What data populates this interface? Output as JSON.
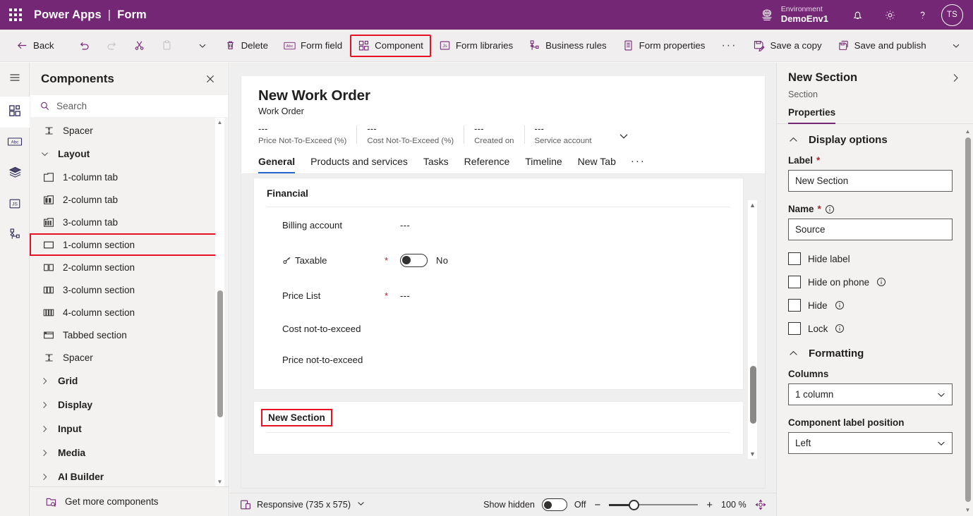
{
  "header": {
    "waffle_icon": "waffle-grid-icon",
    "brand": "Power Apps",
    "separator": "|",
    "app_name": "Form",
    "environment_label": "Environment",
    "environment_name": "DemoEnv1",
    "environment_icon": "environment-globe-icon",
    "notifications_icon": "bell-icon",
    "settings_icon": "gear-icon",
    "help_icon": "question-icon",
    "avatar_initials": "TS",
    "brand_color": "#742774"
  },
  "commandbar": {
    "back": "Back",
    "undo_icon": "undo-icon",
    "redo_icon": "redo-icon",
    "cut_icon": "cut-scissors-icon",
    "paste_icon": "paste-clipboard-icon",
    "more_chevron_icon": "chevron-down-icon",
    "delete": "Delete",
    "form_field": "Form field",
    "component": "Component",
    "form_libraries": "Form libraries",
    "business_rules": "Business rules",
    "form_properties": "Form properties",
    "overflow": "···",
    "save_a_copy": "Save a copy",
    "save_and_publish": "Save and publish",
    "save_chevron_icon": "chevron-down-icon",
    "highlight_color": "#e81123"
  },
  "rail": {
    "items": [
      {
        "name": "hamburger-menu-icon"
      },
      {
        "name": "components-icon",
        "selected": true
      },
      {
        "name": "form-fields-abc-icon"
      },
      {
        "name": "layers-tree-icon"
      },
      {
        "name": "js-libraries-icon"
      },
      {
        "name": "business-rules-icon"
      }
    ]
  },
  "components_panel": {
    "title": "Components",
    "close_icon": "close-icon",
    "search_icon": "search-icon",
    "search_value": "",
    "search_placeholder": "Search",
    "items": [
      {
        "label": "Spacer",
        "icon": "spacer-icon",
        "type": "item"
      },
      {
        "label": "Layout",
        "icon": "chevron-down-icon",
        "type": "group",
        "expanded": true
      },
      {
        "label": "1-column tab",
        "icon": "one-column-tab-icon",
        "type": "item"
      },
      {
        "label": "2-column tab",
        "icon": "two-column-tab-icon",
        "type": "item"
      },
      {
        "label": "3-column tab",
        "icon": "three-column-tab-icon",
        "type": "item"
      },
      {
        "label": "1-column section",
        "icon": "one-column-section-icon",
        "type": "item",
        "highlighted": true
      },
      {
        "label": "2-column section",
        "icon": "two-column-section-icon",
        "type": "item"
      },
      {
        "label": "3-column section",
        "icon": "three-column-section-icon",
        "type": "item"
      },
      {
        "label": "4-column section",
        "icon": "four-column-section-icon",
        "type": "item"
      },
      {
        "label": "Tabbed section",
        "icon": "tabbed-section-icon",
        "type": "item"
      },
      {
        "label": "Spacer",
        "icon": "spacer-icon",
        "type": "item"
      },
      {
        "label": "Grid",
        "icon": "chevron-right-icon",
        "type": "group",
        "expanded": false
      },
      {
        "label": "Display",
        "icon": "chevron-right-icon",
        "type": "group",
        "expanded": false
      },
      {
        "label": "Input",
        "icon": "chevron-right-icon",
        "type": "group",
        "expanded": false
      },
      {
        "label": "Media",
        "icon": "chevron-right-icon",
        "type": "group",
        "expanded": false
      },
      {
        "label": "AI Builder",
        "icon": "chevron-right-icon",
        "type": "group",
        "expanded": false
      }
    ],
    "footer_label": "Get more components",
    "footer_icon": "get-more-components-icon"
  },
  "canvas": {
    "form_title": "New Work Order",
    "form_subtitle": "Work Order",
    "header_fields": [
      {
        "value": "---",
        "label": "Price Not-To-Exceed (%)"
      },
      {
        "value": "---",
        "label": "Cost Not-To-Exceed (%)"
      },
      {
        "value": "---",
        "label": "Created on"
      },
      {
        "value": "---",
        "label": "Service account"
      }
    ],
    "header_chevron_icon": "chevron-down-icon",
    "tabs": [
      {
        "label": "General",
        "active": true
      },
      {
        "label": "Products and services",
        "active": false
      },
      {
        "label": "Tasks",
        "active": false
      },
      {
        "label": "Reference",
        "active": false
      },
      {
        "label": "Timeline",
        "active": false
      },
      {
        "label": "New Tab",
        "active": false
      }
    ],
    "tabs_overflow": "···",
    "section_financial": {
      "title": "Financial",
      "rows": [
        {
          "label": "Billing account",
          "required": "",
          "value": "---",
          "control": "text",
          "icon": ""
        },
        {
          "label": "Taxable",
          "required": "*",
          "value": "No",
          "control": "toggle",
          "icon": "lock-key-icon"
        },
        {
          "label": "Price List",
          "required": "*",
          "value": "---",
          "control": "text",
          "icon": ""
        },
        {
          "label": "Cost not-to-exceed",
          "required": "",
          "value": "",
          "control": "text",
          "icon": ""
        },
        {
          "label": "Price not-to-exceed",
          "required": "",
          "value": "",
          "control": "text",
          "icon": ""
        }
      ]
    },
    "section_new": {
      "title": "New Section",
      "highlighted": true
    },
    "scroll_up_icon": "scroll-up-arrow-icon",
    "scroll_down_icon": "scroll-down-arrow-icon"
  },
  "statusbar": {
    "device_icon": "responsive-device-icon",
    "device_label": "Responsive (735 x 575)",
    "device_chevron_icon": "chevron-down-icon",
    "show_hidden_label": "Show hidden",
    "show_hidden_state": "Off",
    "zoom_out_icon": "minus-icon",
    "zoom_in_icon": "plus-icon",
    "zoom_value": "100 %",
    "fit_icon": "fit-to-screen-icon"
  },
  "properties": {
    "title": "New Section",
    "expand_icon": "chevron-right-icon",
    "subtitle": "Section",
    "tab_label": "Properties",
    "accent_color": "#742774",
    "display_options": {
      "section_title": "Display options",
      "collapse_icon": "chevron-up-icon",
      "label_field_label": "Label",
      "label_field_required": "*",
      "label_field_value": "New Section",
      "name_field_label": "Name",
      "name_field_required": "*",
      "name_field_info_icon": "info-icon",
      "name_field_value": "Source",
      "checkboxes": [
        {
          "label": "Hide label",
          "checked": false,
          "info": false
        },
        {
          "label": "Hide on phone",
          "checked": false,
          "info": true
        },
        {
          "label": "Hide",
          "checked": false,
          "info": true
        },
        {
          "label": "Lock",
          "checked": false,
          "info": true
        }
      ]
    },
    "formatting": {
      "section_title": "Formatting",
      "collapse_icon": "chevron-up-icon",
      "columns_label": "Columns",
      "columns_value": "1 column",
      "label_position_label": "Component label position",
      "label_position_value": "Left",
      "chevron_icon": "chevron-down-icon"
    }
  }
}
